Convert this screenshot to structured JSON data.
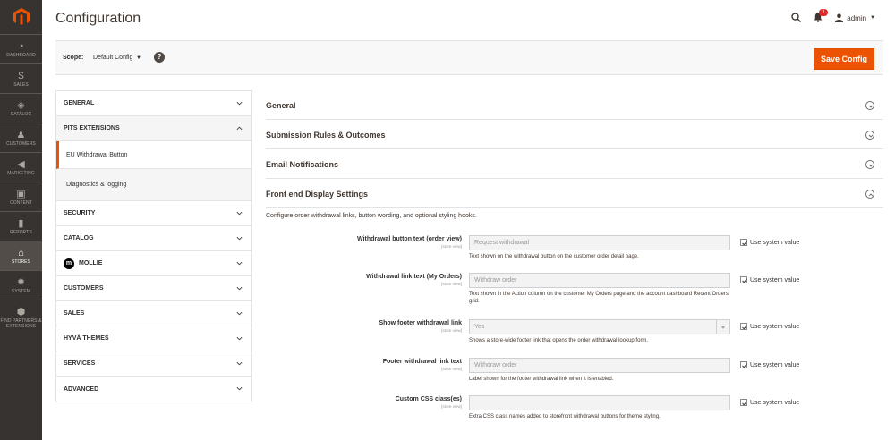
{
  "nav": {
    "items": [
      {
        "label": "DASHBOARD",
        "icon": "dashboard-icon"
      },
      {
        "label": "SALES",
        "icon": "dollar-icon"
      },
      {
        "label": "CATALOG",
        "icon": "cube-icon"
      },
      {
        "label": "CUSTOMERS",
        "icon": "person-icon"
      },
      {
        "label": "MARKETING",
        "icon": "megaphone-icon"
      },
      {
        "label": "CONTENT",
        "icon": "layout-icon"
      },
      {
        "label": "REPORTS",
        "icon": "bar-chart-icon"
      },
      {
        "label": "STORES",
        "icon": "store-icon"
      },
      {
        "label": "SYSTEM",
        "icon": "gear-icon"
      },
      {
        "label": "FIND PARTNERS & EXTENSIONS",
        "icon": "box-icon"
      }
    ]
  },
  "header": {
    "title": "Configuration",
    "notification_count": "1",
    "user": "admin"
  },
  "scope": {
    "label": "Scope:",
    "value": "Default Config",
    "save_label": "Save Config"
  },
  "tabs": {
    "general": "GENERAL",
    "pits": "PITS EXTENSIONS",
    "pits_sub1": "EU Withdrawal Button",
    "pits_sub2": "Diagnostics & logging",
    "security": "SECURITY",
    "catalog": "CATALOG",
    "mollie": "MOLLIE",
    "mollie_letter": "m",
    "customers": "CUSTOMERS",
    "sales": "SALES",
    "hyva": "HYVÄ THEMES",
    "services": "SERVICES",
    "advanced": "ADVANCED"
  },
  "sections": {
    "s1": "General",
    "s2": "Submission Rules & Outcomes",
    "s3": "Email Notifications",
    "s4": "Front end Display Settings",
    "s4_desc": "Configure order withdrawal links, button wording, and optional styling hooks."
  },
  "fields": [
    {
      "label": "Withdrawal button text (order view)",
      "scope": "[store view]",
      "value": "Request withdrawal",
      "note": "Text shown on the withdrawal button on the customer order detail page.",
      "system": "Use system value"
    },
    {
      "label": "Withdrawal link text (My Orders)",
      "scope": "[store view]",
      "value": "Withdraw order",
      "note": "Text shown in the Action column on the customer My Orders page and the account dashboard Recent Orders grid.",
      "system": "Use system value"
    },
    {
      "label": "Show footer withdrawal link",
      "scope": "[store view]",
      "value": "Yes",
      "note": "Shows a store-wide footer link that opens the order withdrawal lookup form.",
      "system": "Use system value"
    },
    {
      "label": "Footer withdrawal link text",
      "scope": "[store view]",
      "value": "Withdraw order",
      "note": "Label shown for the footer withdrawal link when it is enabled.",
      "system": "Use system value"
    },
    {
      "label": "Custom CSS class(es)",
      "scope": "[store view]",
      "value": "",
      "note": "Extra CSS class names added to storefront withdrawal buttons for theme styling.",
      "system": "Use system value"
    }
  ],
  "colors": {
    "accent": "#eb5202",
    "nav_bg": "#373330"
  }
}
